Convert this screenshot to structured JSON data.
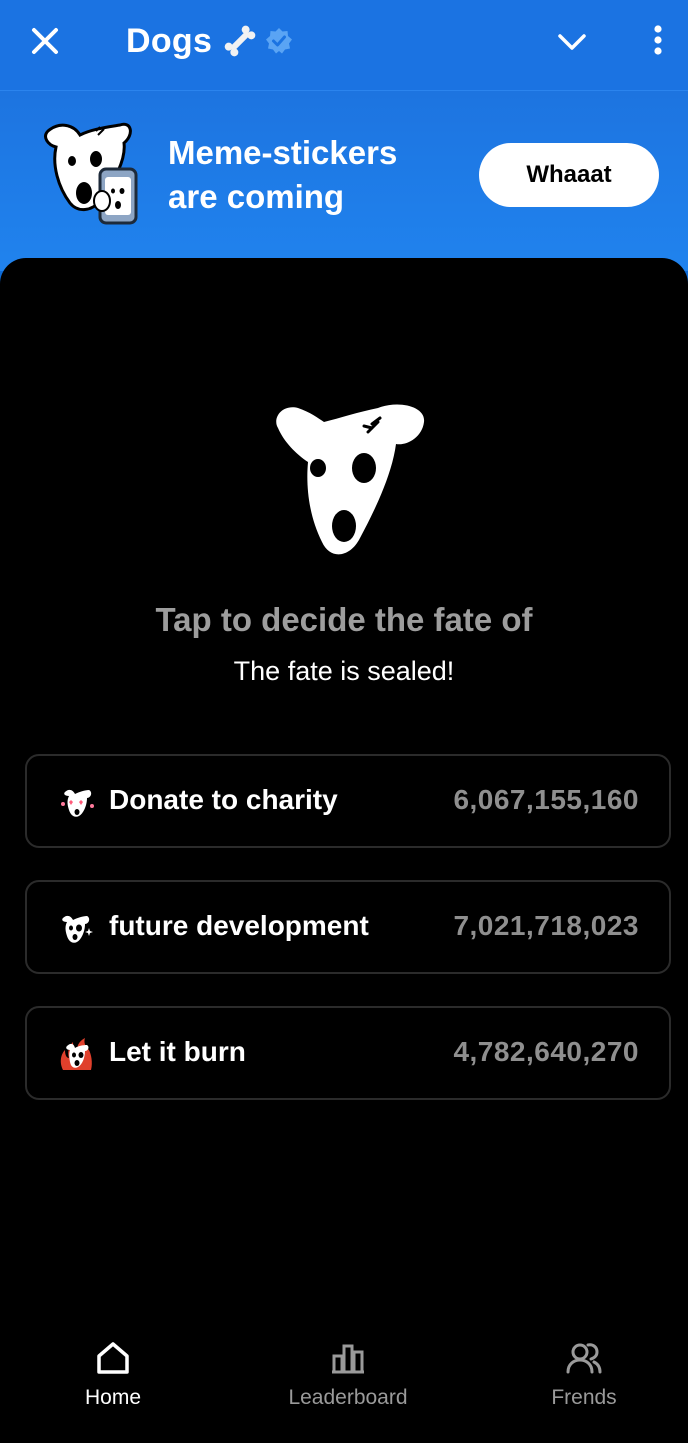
{
  "header": {
    "title": "Dogs",
    "icons": {
      "close": "close-icon",
      "bone": "bone-icon",
      "verified": "verified-badge-icon",
      "chevron": "chevron-down-icon",
      "menu": "more-vertical-icon"
    }
  },
  "banner": {
    "line1": "Meme-stickers",
    "line2": "are coming",
    "button_label": "Whaaat"
  },
  "main": {
    "headline": "Tap to decide the fate of",
    "subline": "The fate is sealed!",
    "options": [
      {
        "label": "Donate to charity",
        "value": "6,067,155,160",
        "icon": "dog-love-icon"
      },
      {
        "label": "future development",
        "value": "7,021,718,023",
        "icon": "dog-sparkle-icon"
      },
      {
        "label": "Let it burn",
        "value": "4,782,640,270",
        "icon": "dog-fire-icon"
      }
    ]
  },
  "nav": {
    "items": [
      {
        "label": "Home",
        "icon": "home-icon",
        "active": true
      },
      {
        "label": "Leaderboard",
        "icon": "leaderboard-icon",
        "active": false
      },
      {
        "label": "Frends",
        "icon": "friends-icon",
        "active": false
      }
    ]
  },
  "colors": {
    "header_blue": "#1b73e2",
    "active_nav": "#ffffff",
    "inactive_nav": "#9a9a9a",
    "value_gray": "#8f8f8f",
    "headline_gray": "#9d9d9d"
  }
}
